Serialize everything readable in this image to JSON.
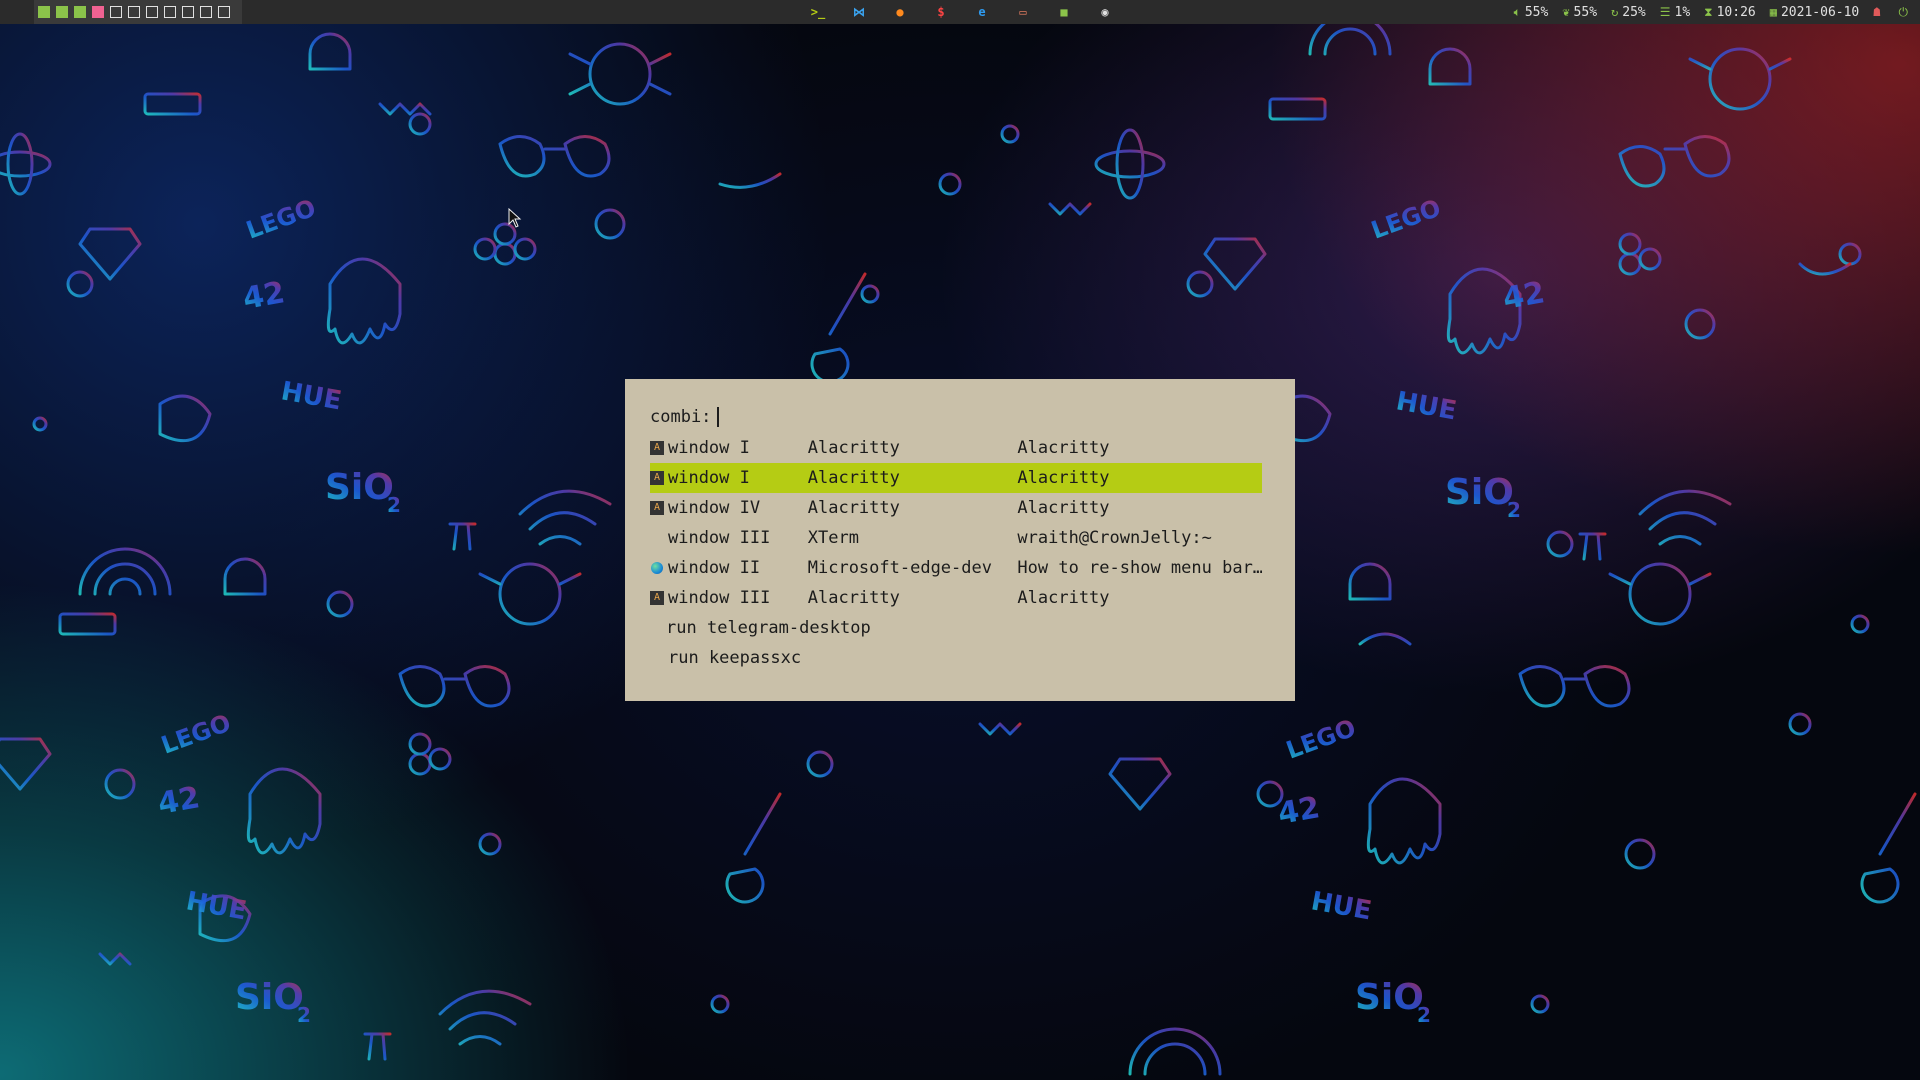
{
  "topbar": {
    "workspaces": [
      {
        "state": "occupied"
      },
      {
        "state": "occupied"
      },
      {
        "state": "occupied"
      },
      {
        "state": "urgent"
      },
      {
        "state": "empty"
      },
      {
        "state": "empty"
      },
      {
        "state": "empty"
      },
      {
        "state": "empty"
      },
      {
        "state": "empty"
      },
      {
        "state": "empty"
      },
      {
        "state": "empty"
      }
    ],
    "apps": [
      {
        "name": "terminal-icon",
        "glyph": ">_",
        "color": "#b5cc14"
      },
      {
        "name": "vscode-icon",
        "glyph": "⋈",
        "color": "#3aa3f0"
      },
      {
        "name": "firefox-icon",
        "glyph": "●",
        "color": "#ff8a1e"
      },
      {
        "name": "money-icon",
        "glyph": "$",
        "color": "#ff4444"
      },
      {
        "name": "edge-icon",
        "glyph": "e",
        "color": "#2e9bf0"
      },
      {
        "name": "folder-icon",
        "glyph": "▭",
        "color": "#e07a5f"
      },
      {
        "name": "keepass-icon",
        "glyph": "■",
        "color": "#8bc34a"
      },
      {
        "name": "chrome-icon",
        "glyph": "◉",
        "color": "#e0e0e0"
      }
    ],
    "status": {
      "volume": {
        "icon": "volume-icon",
        "value": "55%",
        "color": "#8bc34a"
      },
      "battery": {
        "icon": "battery-leaf-icon",
        "value": "55%",
        "color": "#8bc34a"
      },
      "cpu": {
        "icon": "cpu-icon",
        "value": "25%",
        "color": "#8bc34a"
      },
      "memory": {
        "icon": "memory-icon",
        "value": "1%",
        "color": "#8bc34a"
      },
      "time": {
        "icon": "hourglass-icon",
        "value": "10:26",
        "color": "#8bc34a"
      },
      "date": {
        "icon": "calendar-icon",
        "value": "2021-06-10",
        "color": "#8bc34a"
      },
      "tray": {
        "icon": "ghost-icon",
        "color": "#e05a5a"
      },
      "extra": {
        "icon": "power-icon",
        "color": "#8bc34a"
      }
    }
  },
  "launcher": {
    "prompt": "combi:",
    "input_value": "",
    "selected_color": "#b5cc14",
    "background": "#c9c0a9",
    "rows": [
      {
        "icon": "alacritty",
        "col1": "window I",
        "col2": "Alacritty",
        "col3": "Alacritty",
        "selected": false
      },
      {
        "icon": "alacritty",
        "col1": "window I",
        "col2": "Alacritty",
        "col3": "Alacritty",
        "selected": true
      },
      {
        "icon": "alacritty",
        "col1": "window IV",
        "col2": "Alacritty",
        "col3": "Alacritty",
        "selected": false
      },
      {
        "icon": "none",
        "col1": "window III",
        "col2": "XTerm",
        "col3": "wraith@CrownJelly:~",
        "selected": false
      },
      {
        "icon": "edge",
        "col1": "window II",
        "col2": "Microsoft-edge-dev",
        "col3": "How to re-show menu bar…",
        "selected": false
      },
      {
        "icon": "alacritty",
        "col1": "window III",
        "col2": "Alacritty",
        "col3": "Alacritty",
        "selected": false
      },
      {
        "icon": "none",
        "col1": "run telegram-desktop",
        "col2": "",
        "col3": "",
        "selected": false
      },
      {
        "icon": "none",
        "col1": "run keepassxc",
        "col2": "",
        "col3": "",
        "selected": false
      }
    ]
  },
  "wallpaper": {
    "labels": [
      "HUE",
      "42",
      "SiO",
      "2",
      "LEGO"
    ]
  }
}
